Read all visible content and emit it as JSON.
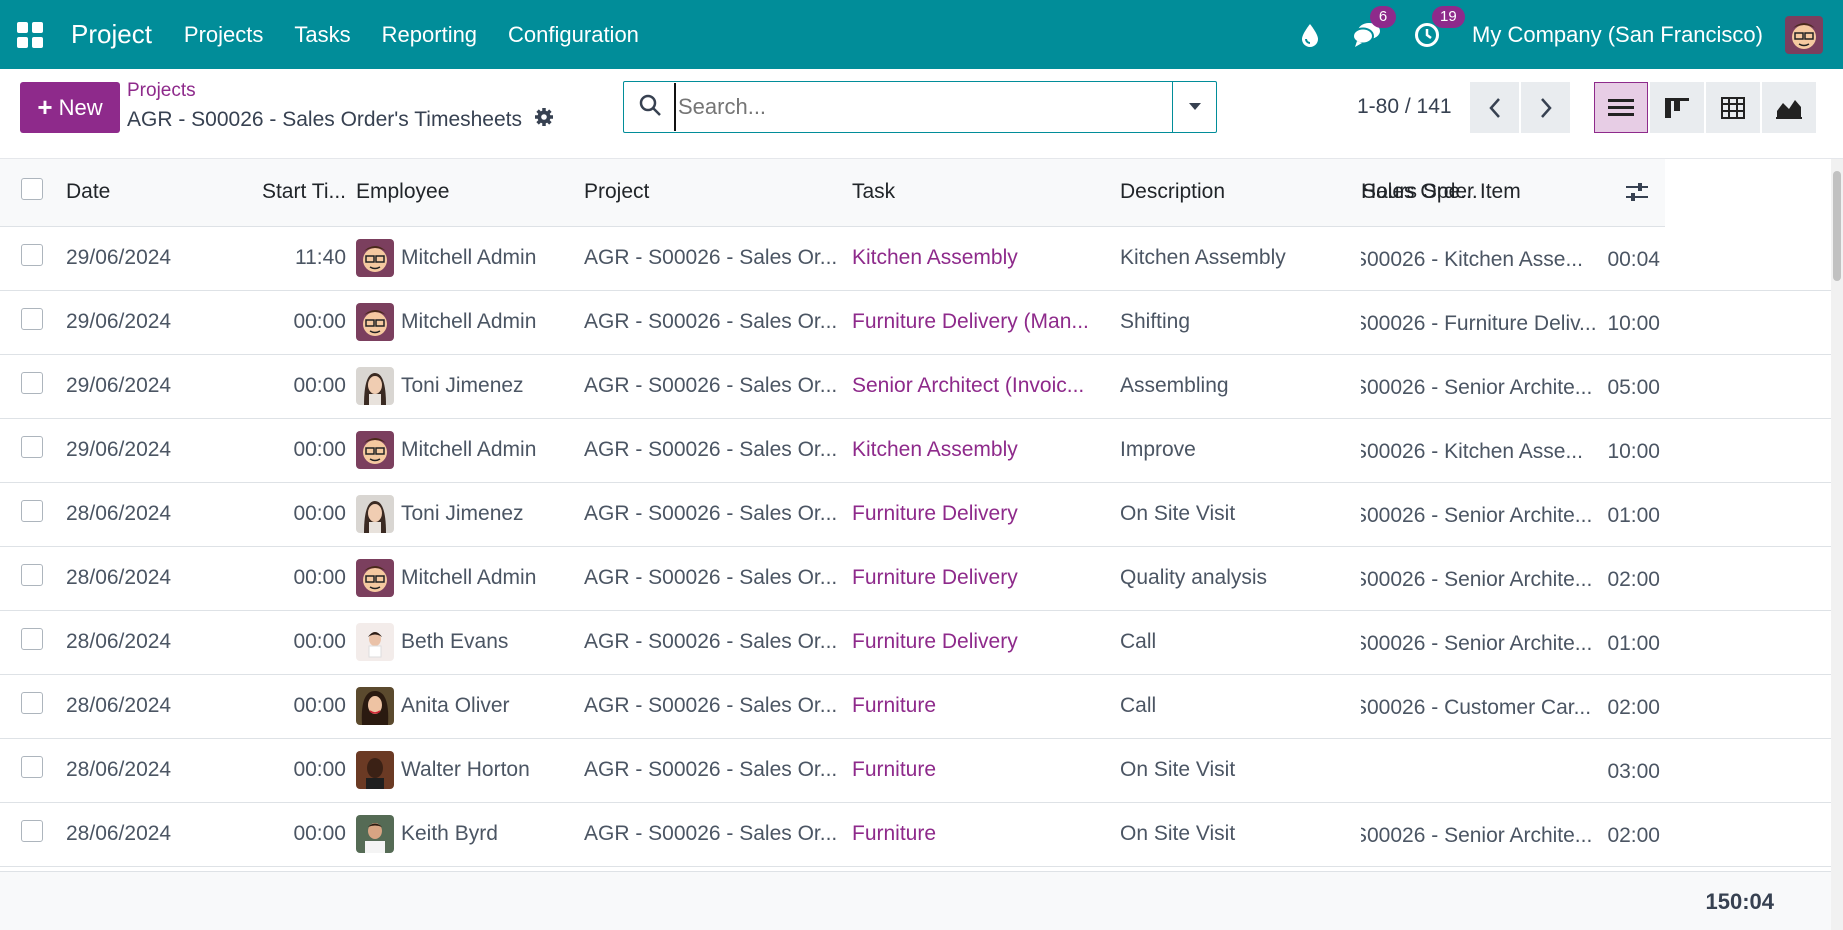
{
  "navbar": {
    "brand": "Project",
    "menu": [
      "Projects",
      "Tasks",
      "Reporting",
      "Configuration"
    ],
    "messages_count": "6",
    "activities_count": "19",
    "company": "My Company (San Francisco)"
  },
  "control": {
    "new_label": "New",
    "breadcrumb_parent": "Projects",
    "breadcrumb_current": "AGR - S00026 - Sales Order's Timesheets",
    "search_placeholder": "Search...",
    "pager": "1-80 / 141"
  },
  "table": {
    "columns": [
      "Date",
      "Start Ti...",
      "Employee",
      "Project",
      "Task",
      "Description",
      "Sales Order Item",
      "Hours Spe..."
    ],
    "rows": [
      {
        "date": "29/06/2024",
        "start": "11:40",
        "employee": "Mitchell Admin",
        "avatar": "admin",
        "project": "AGR - S00026 - Sales Or...",
        "task": "Kitchen Assembly",
        "description": "Kitchen Assembly",
        "so_item": "S00026 - Kitchen Asse...",
        "hours": "00:04"
      },
      {
        "date": "29/06/2024",
        "start": "00:00",
        "employee": "Mitchell Admin",
        "avatar": "admin",
        "project": "AGR - S00026 - Sales Or...",
        "task": "Furniture Delivery (Man...",
        "description": "Shifting",
        "so_item": "S00026 - Furniture Deliv...",
        "hours": "10:00"
      },
      {
        "date": "29/06/2024",
        "start": "00:00",
        "employee": "Toni Jimenez",
        "avatar": "toni",
        "project": "AGR - S00026 - Sales Or...",
        "task": "Senior Architect (Invoic...",
        "description": "Assembling",
        "so_item": "S00026 - Senior Archite...",
        "hours": "05:00"
      },
      {
        "date": "29/06/2024",
        "start": "00:00",
        "employee": "Mitchell Admin",
        "avatar": "admin",
        "project": "AGR - S00026 - Sales Or...",
        "task": "Kitchen Assembly",
        "description": "Improve",
        "so_item": "S00026 - Kitchen Asse...",
        "hours": "10:00"
      },
      {
        "date": "28/06/2024",
        "start": "00:00",
        "employee": "Toni Jimenez",
        "avatar": "toni",
        "project": "AGR - S00026 - Sales Or...",
        "task": "Furniture Delivery",
        "description": "On Site Visit",
        "so_item": "S00026 - Senior Archite...",
        "hours": "01:00"
      },
      {
        "date": "28/06/2024",
        "start": "00:00",
        "employee": "Mitchell Admin",
        "avatar": "admin",
        "project": "AGR - S00026 - Sales Or...",
        "task": "Furniture Delivery",
        "description": "Quality analysis",
        "so_item": "S00026 - Senior Archite...",
        "hours": "02:00"
      },
      {
        "date": "28/06/2024",
        "start": "00:00",
        "employee": "Beth Evans",
        "avatar": "beth",
        "project": "AGR - S00026 - Sales Or...",
        "task": "Furniture Delivery",
        "description": "Call",
        "so_item": "S00026 - Senior Archite...",
        "hours": "01:00"
      },
      {
        "date": "28/06/2024",
        "start": "00:00",
        "employee": "Anita Oliver",
        "avatar": "anita",
        "project": "AGR - S00026 - Sales Or...",
        "task": "Furniture",
        "description": "Call",
        "so_item": "S00026 - Customer Car...",
        "hours": "02:00"
      },
      {
        "date": "28/06/2024",
        "start": "00:00",
        "employee": "Walter Horton",
        "avatar": "walter",
        "project": "AGR - S00026 - Sales Or...",
        "task": "Furniture",
        "description": "On Site Visit",
        "so_item": "",
        "hours": "03:00"
      },
      {
        "date": "28/06/2024",
        "start": "00:00",
        "employee": "Keith Byrd",
        "avatar": "keith",
        "project": "AGR - S00026 - Sales Or...",
        "task": "Furniture",
        "description": "On Site Visit",
        "so_item": "S00026 - Senior Archite...",
        "hours": "02:00"
      },
      {
        "date": "",
        "start": "",
        "employee": "",
        "avatar": "blank",
        "project": "",
        "task": "",
        "description": "",
        "so_item": "",
        "hours": ""
      }
    ],
    "total_hours": "150:04"
  }
}
